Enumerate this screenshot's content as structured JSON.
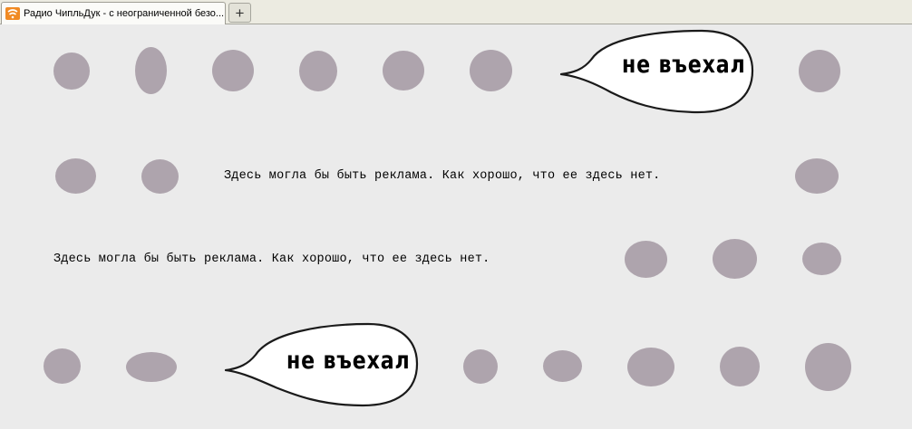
{
  "browser": {
    "tab": {
      "title": "Радио ЧипльДук - с неограниченной безо...",
      "favicon": "radio-favicon-icon"
    },
    "new_tab_label": "+"
  },
  "page": {
    "ad_text": "Здесь могла бы быть реклама. Как хорошо, что ее здесь нет.",
    "bubble_text": "не въехал",
    "dot_color": "#aea4ad",
    "background": "#ebebeb"
  }
}
